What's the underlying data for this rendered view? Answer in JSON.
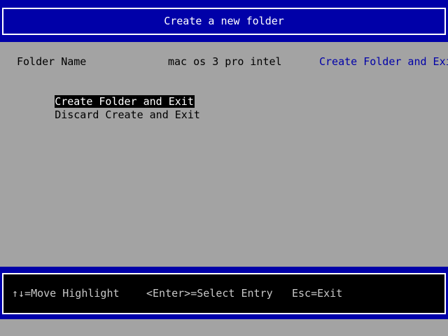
{
  "header": {
    "title": "Create a new folder"
  },
  "form": {
    "field_label": "Folder Name",
    "field_value": "mac os 3 pro intel",
    "help_text": "Create Folder and Exit"
  },
  "menu": {
    "items": [
      {
        "label": "Create Folder and Exit",
        "selected": true
      },
      {
        "label": "Discard Create and Exit",
        "selected": false
      }
    ]
  },
  "footer": {
    "move": "↑↓=Move Highlight",
    "select": "<Enter>=Select Entry",
    "exit": "Esc=Exit"
  },
  "colors": {
    "band_blue": "#0000a8",
    "body_gray": "#a3a3a3",
    "help_blue": "#0000a8"
  }
}
